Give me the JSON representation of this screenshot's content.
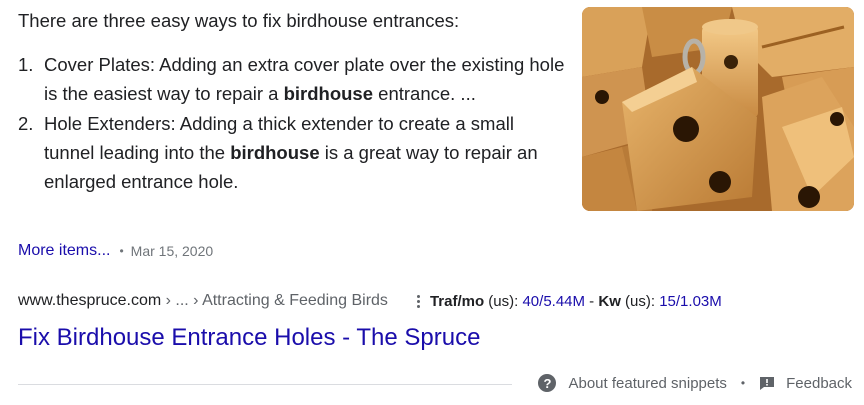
{
  "snippet": {
    "intro": "There are three easy ways to fix birdhouse entrances:",
    "steps": [
      {
        "number": "1.",
        "before": "Cover Plates: Adding an extra cover plate over the existing hole is the easiest way to repair a ",
        "bold": "birdhouse",
        "after": " entrance. ..."
      },
      {
        "number": "2.",
        "before": "Hole Extenders: Adding a thick extender to create a small tunnel leading into the ",
        "bold": "birdhouse",
        "after": " is a great way to repair an enlarged entrance hole."
      }
    ],
    "more_items": "More items...",
    "separator": "•",
    "date": "Mar 15, 2020",
    "image_icon": "wooden-birdhouses-photo"
  },
  "result": {
    "domain": "www.thespruce.com",
    "breadcrumb": " › ... › Attracting & Feeding Birds",
    "metrics": {
      "traf_label": "Traf/mo",
      "traf_region": " (us): ",
      "traf_value": "40/5.44M",
      "dash": " - ",
      "kw_label": "Kw",
      "kw_region": " (us): ",
      "kw_value": "15/1.03M"
    },
    "title": "Fix Birdhouse Entrance Holes - The Spruce"
  },
  "footer": {
    "help_icon": "?",
    "about": "About featured snippets",
    "separator": "•",
    "feedback": "Feedback"
  },
  "colors": {
    "link": "#1a0dab",
    "text": "#202124",
    "secondary": "#70757a",
    "divider": "#dadce0"
  }
}
